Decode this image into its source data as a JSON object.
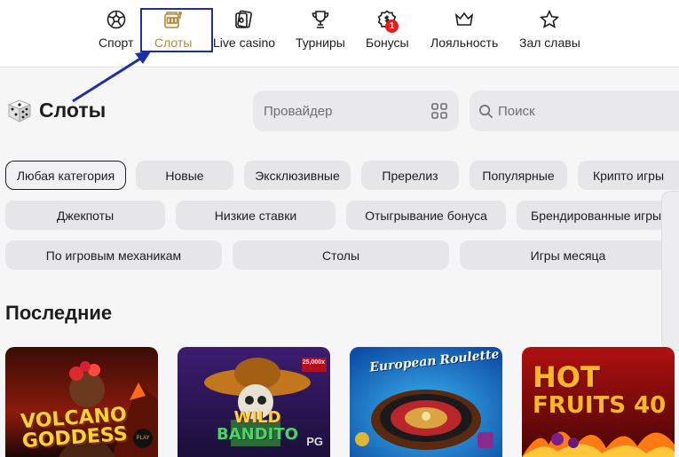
{
  "nav": {
    "items": [
      {
        "label": "Спорт",
        "icon": "soccer-ball-icon"
      },
      {
        "label": "Слоты",
        "icon": "slot-machine-icon",
        "active": true
      },
      {
        "label": "Live casino",
        "icon": "live-casino-icon"
      },
      {
        "label": "Турниры",
        "icon": "trophy-icon"
      },
      {
        "label": "Бонусы",
        "icon": "bonus-icon",
        "badge": "1"
      },
      {
        "label": "Лояльность",
        "icon": "crown-icon"
      },
      {
        "label": "Зал славы",
        "icon": "star-icon"
      }
    ]
  },
  "page": {
    "title": "Слоты",
    "provider_placeholder": "Провайдер",
    "search_placeholder": "Поиск"
  },
  "categories": [
    "Любая категория",
    "Новые",
    "Эксклюзивные",
    "Пререлиз",
    "Популярные",
    "Крипто игры",
    "Джекпоты",
    "Низкие ставки",
    "Отыгрывание бонуса",
    "Брендированные игры",
    "По игровым механикам",
    "Столы",
    "Игры месяца"
  ],
  "recent": {
    "title": "Последние",
    "games": [
      {
        "line1": "VOLCANO",
        "line2": "GODDESS",
        "tag": "PLAY"
      },
      {
        "line1": "WILD",
        "line2": "BANDITO",
        "tag": "PG",
        "prize": "25,000x"
      },
      {
        "line1": "European",
        "line2": "Roulette"
      },
      {
        "line1": "HOT",
        "line2": "FRUITS 40"
      }
    ]
  },
  "colors": {
    "active_nav": "#b08a3c",
    "highlight_box": "#1d2fa5",
    "badge": "#e02020"
  }
}
